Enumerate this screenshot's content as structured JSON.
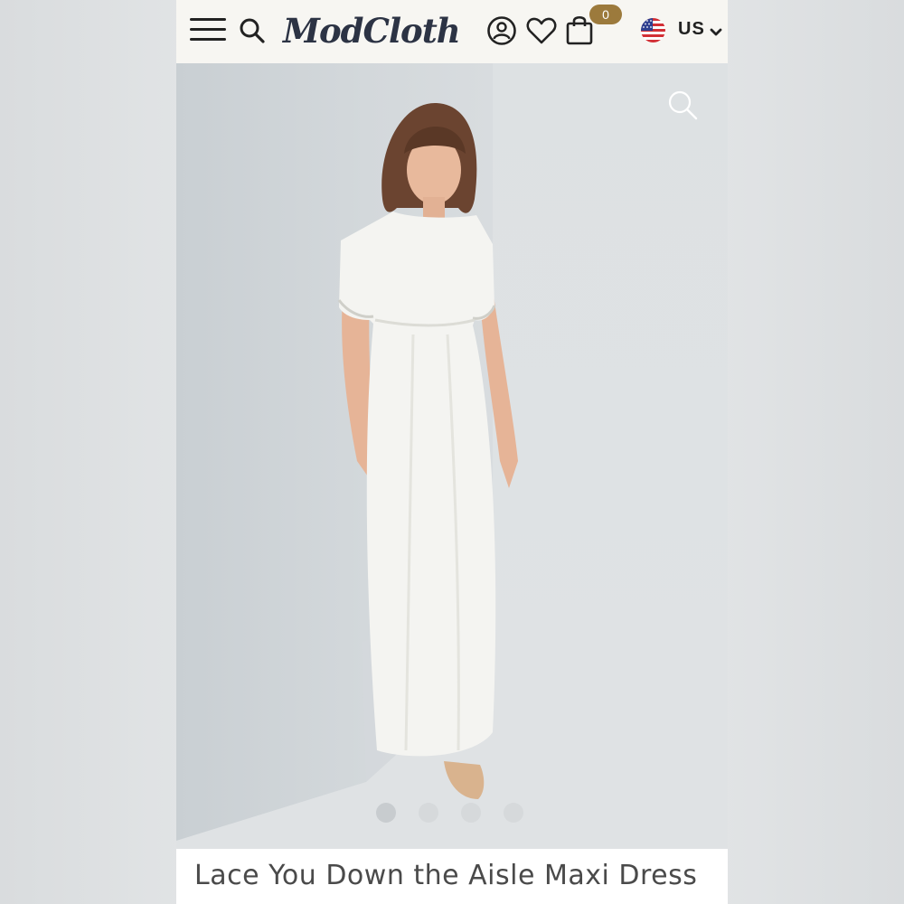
{
  "header": {
    "logo_text": "ModCloth",
    "cart_count": "0",
    "locale_label": "US",
    "icons": [
      "menu-icon",
      "search-icon",
      "account-icon",
      "heart-icon",
      "bag-icon",
      "us-flag-icon",
      "chevron-down-icon"
    ]
  },
  "gallery": {
    "zoom_icon": "zoom-icon",
    "slide_count": 4,
    "active_slide": 1
  },
  "product": {
    "title": "Lace You Down the Aisle Maxi Dress"
  },
  "colors": {
    "brand_navy": "#2c3344",
    "badge_gold": "#9c7a3c",
    "header_bg": "#f7f6f2"
  }
}
